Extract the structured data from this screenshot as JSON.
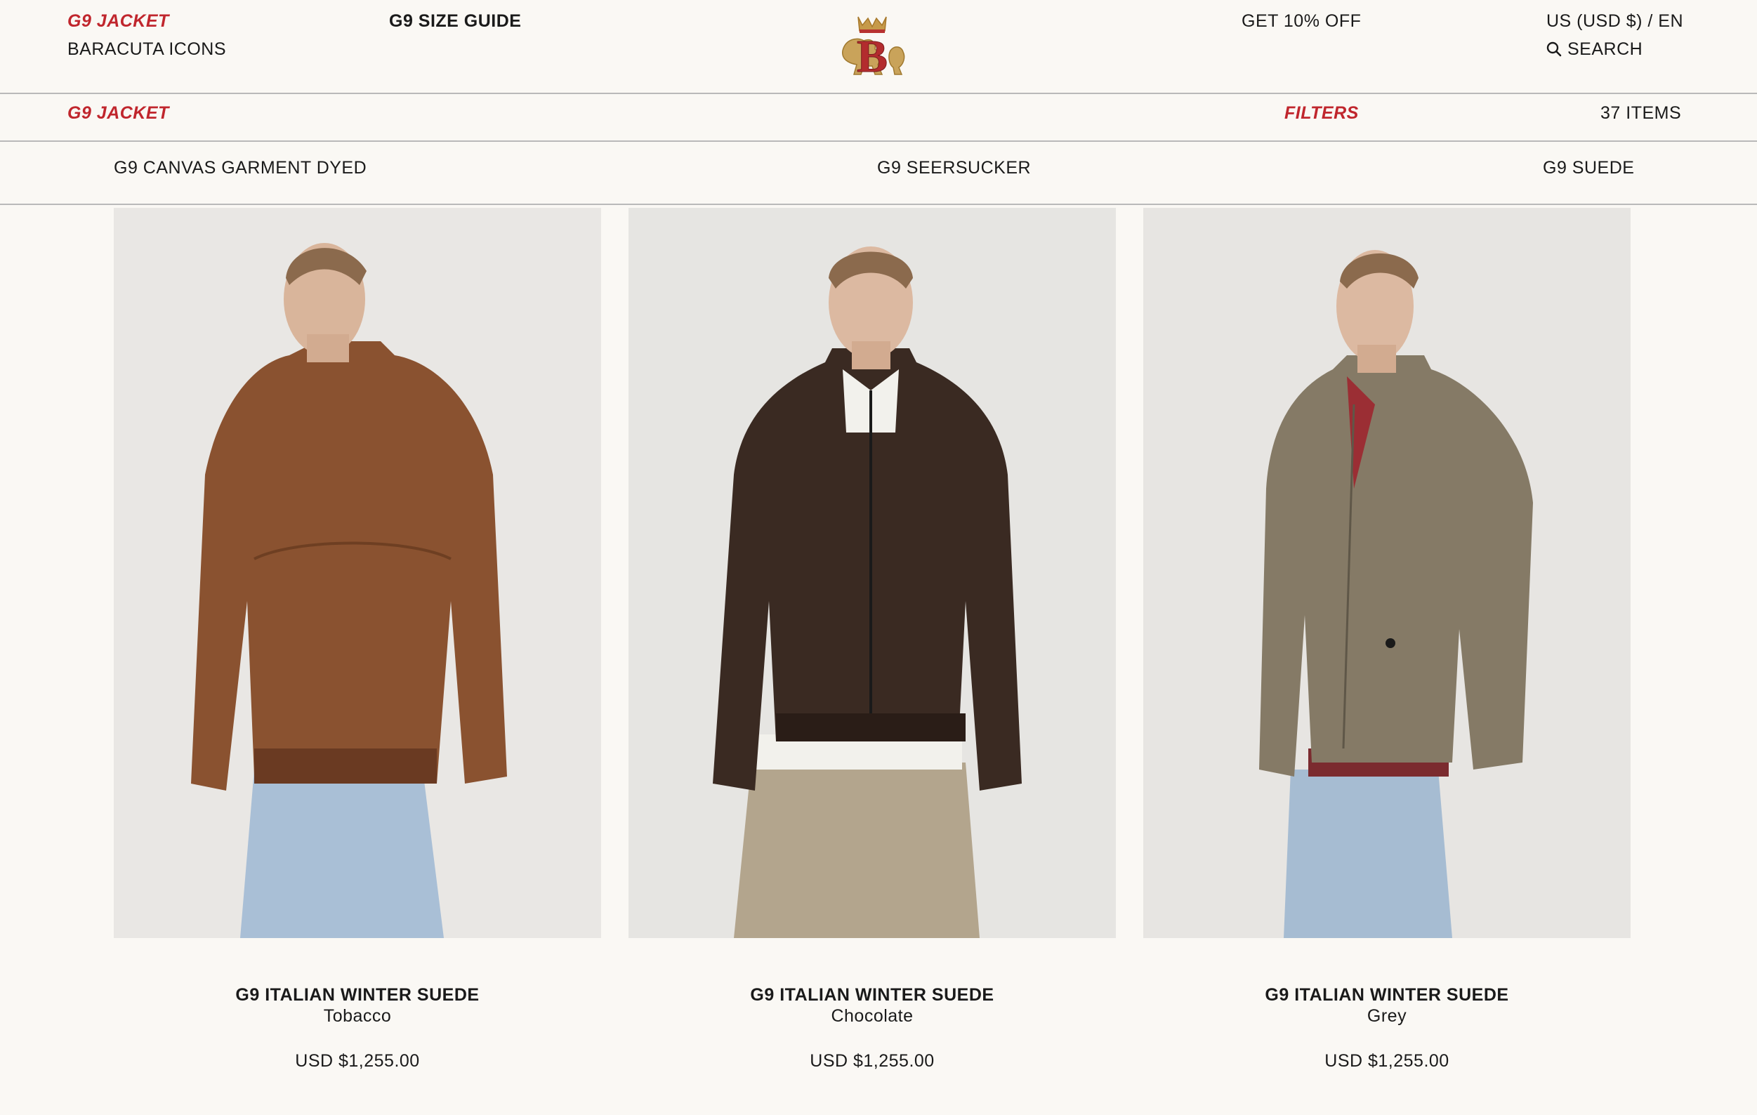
{
  "header": {
    "breadcrumb_current": "G9 JACKET",
    "breadcrumb_parent": "BARACUTA ICONS",
    "size_guide_link": "G9 SIZE GUIDE",
    "promo_link": "GET 10% OFF",
    "locale": "US (USD $) / EN",
    "search_label": "SEARCH",
    "logo_icon": "baracuta-crest-logo",
    "search_icon": "search-icon"
  },
  "toolbar": {
    "collection_title": "G9 JACKET",
    "filters_label": "FILTERS",
    "item_count": "37 ITEMS"
  },
  "categories": [
    {
      "label": "G9 CANVAS GARMENT DYED"
    },
    {
      "label": "G9 SEERSUCKER"
    },
    {
      "label": "G9 SUEDE"
    }
  ],
  "products": [
    {
      "name": "G9 ITALIAN WINTER SUEDE",
      "color": "Tobacco",
      "price": "USD $1,255.00",
      "jacket_hex": "#8a5230",
      "pants_hex": "#a9bfd6"
    },
    {
      "name": "G9 ITALIAN WINTER SUEDE",
      "color": "Chocolate",
      "price": "USD $1,255.00",
      "jacket_hex": "#3a2a22",
      "pants_hex": "#b3a58d"
    },
    {
      "name": "G9 ITALIAN WINTER SUEDE",
      "color": "Grey",
      "price": "USD $1,255.00",
      "jacket_hex": "#857a66",
      "pants_hex": "#a6bcd2"
    }
  ],
  "colors": {
    "accent": "#c0262d",
    "background": "#faf8f4",
    "photo_bg": "#e8e6e3",
    "divider": "#b9b9b9"
  }
}
